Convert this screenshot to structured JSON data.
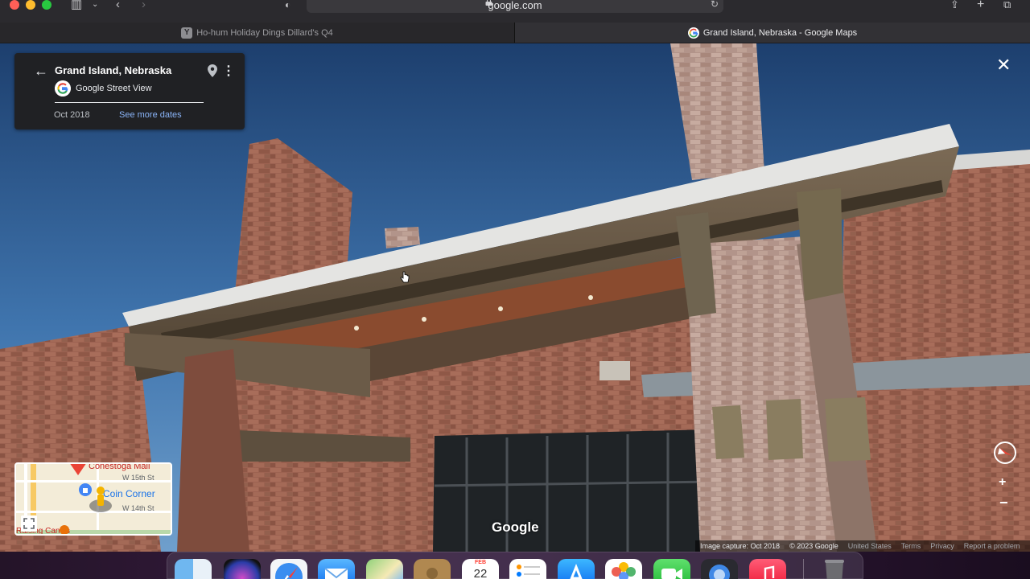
{
  "browser": {
    "url": "google.com",
    "tabs": [
      {
        "label": "Ho-hum Holiday Dings Dillard's Q4",
        "favicon": "Y",
        "active": false
      },
      {
        "label": "Grand Island, Nebraska - Google Maps",
        "active": true
      }
    ]
  },
  "streetview": {
    "place_title": "Grand Island, Nebraska",
    "source_label": "Google Street View",
    "capture_date": "Oct 2018",
    "more_dates_label": "See more dates",
    "watermark": "Google",
    "attribution": {
      "image_capture": "Image capture: Oct 2018",
      "copyright": "© 2023 Google",
      "links": [
        "United States",
        "Terms",
        "Privacy",
        "Report a problem"
      ]
    },
    "minimap": {
      "labels": {
        "mall": "Conestoga Mall",
        "corner": "Coin Corner",
        "street_15": "W 15th St",
        "street_14": "W 14th St",
        "canes": "Raising Cane's"
      }
    },
    "zoom": {
      "in": "+",
      "out": "−"
    }
  },
  "dock": {
    "calendar": {
      "month": "FEB",
      "day": "22"
    },
    "apps": [
      "finder-icon",
      "siri-icon",
      "safari-icon",
      "mail-icon",
      "maps-icon",
      "contacts-icon",
      "calendar-icon",
      "reminders-icon",
      "app-store-icon",
      "photos-icon",
      "facetime-icon",
      "screen-sharing-icon",
      "music-icon",
      "trash-icon"
    ]
  },
  "colors": {
    "accent_link": "#8ab4f8",
    "panel_bg": "#202124",
    "pin_red": "#ea4335"
  }
}
